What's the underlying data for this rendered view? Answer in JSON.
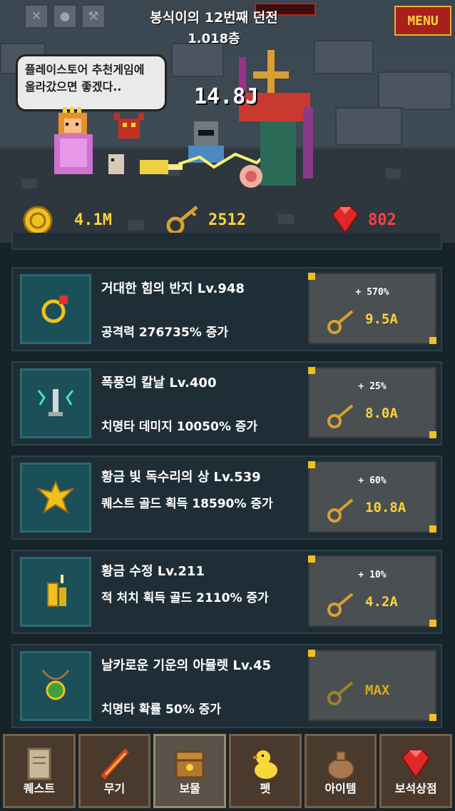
{
  "header": {
    "title": "봉식이의 12번째 던전",
    "floor": "1.018층",
    "menu_label": "MENU",
    "hud_icons": [
      "swords-icon",
      "bread-icon",
      "hammer-icon"
    ]
  },
  "scene": {
    "speech_bubble": "플레이스토어 추천게임에 올라갔으면 좋겠다..",
    "damage_text": "14.8J",
    "boss_hp_fraction": 0.0
  },
  "currency": {
    "gold": "4.1M",
    "keys": "2512",
    "gems": "802"
  },
  "colors": {
    "gold_text": "#ffd23a",
    "gem_text": "#ff4040",
    "menu_bg": "#a8201a"
  },
  "items": [
    {
      "name": "거대한 힘의 반지 Lv.948",
      "desc": "공격력 276735% 증가",
      "icon": "ring-icon",
      "pct": "+ 570%",
      "cost": "9.5A",
      "max": false
    },
    {
      "name": "폭풍의 칼날 Lv.400",
      "desc": "치명타 데미지 10050% 증가",
      "icon": "storm-blade-icon",
      "pct": "+ 25%",
      "cost": "8.0A",
      "max": false
    },
    {
      "name": "황금 빛 독수리의 상 Lv.539",
      "desc": "퀘스트 골드 획득 18590% 증가",
      "icon": "golden-eagle-icon",
      "pct": "+ 60%",
      "cost": "10.8A",
      "max": false
    },
    {
      "name": "황금 수정 Lv.211",
      "desc": "적 처치 획득 골드 2110% 증가",
      "icon": "golden-crystal-icon",
      "pct": "+ 10%",
      "cost": "4.2A",
      "max": false
    },
    {
      "name": "날카로운 기운의 아뮬렛 Lv.45",
      "desc": "치명타 확률 50% 증가",
      "icon": "amulet-icon",
      "pct": "",
      "cost": "MAX",
      "max": true
    }
  ],
  "nav": [
    {
      "label": "퀘스트",
      "icon": "scroll-icon",
      "active": false
    },
    {
      "label": "무기",
      "icon": "flame-sword-icon",
      "active": false
    },
    {
      "label": "보물",
      "icon": "treasure-chest-icon",
      "active": true
    },
    {
      "label": "펫",
      "icon": "chick-icon",
      "active": false
    },
    {
      "label": "아이템",
      "icon": "bag-icon",
      "active": false
    },
    {
      "label": "보석상점",
      "icon": "gem-icon",
      "active": false
    }
  ]
}
